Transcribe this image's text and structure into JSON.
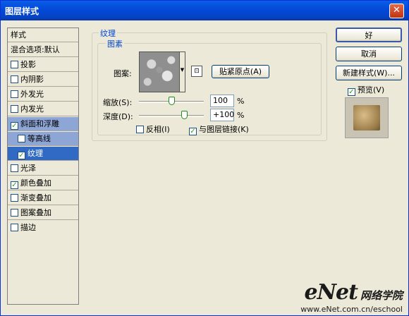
{
  "window": {
    "title": "图层样式",
    "close_glyph": "✕"
  },
  "sidebar": {
    "items": [
      {
        "label": "样式",
        "checkbox": false
      },
      {
        "label": "混合选项:默认",
        "checkbox": false
      },
      {
        "label": "投影",
        "checkbox": true,
        "checked": false
      },
      {
        "label": "内阴影",
        "checkbox": true,
        "checked": false
      },
      {
        "label": "外发光",
        "checkbox": true,
        "checked": false
      },
      {
        "label": "内发光",
        "checkbox": true,
        "checked": false
      },
      {
        "label": "斜面和浮雕",
        "checkbox": true,
        "checked": true
      },
      {
        "label": "等高线",
        "checkbox": true,
        "checked": false
      },
      {
        "label": "纹理",
        "checkbox": true,
        "checked": true
      },
      {
        "label": "光泽",
        "checkbox": true,
        "checked": false
      },
      {
        "label": "颜色叠加",
        "checkbox": true,
        "checked": true
      },
      {
        "label": "渐变叠加",
        "checkbox": true,
        "checked": false
      },
      {
        "label": "图案叠加",
        "checkbox": true,
        "checked": false
      },
      {
        "label": "描边",
        "checkbox": true,
        "checked": false
      }
    ]
  },
  "texture": {
    "group_title": "纹理",
    "sub_group_title": "图素",
    "pattern_label": "图案:",
    "snap_origin_button": "贴紧原点(A)",
    "scale_label": "缩放(S):",
    "scale_value": "100",
    "scale_level_percent": 100,
    "scale_unit": "%",
    "depth_label": "深度(D):",
    "depth_value": "+100",
    "depth_level_percent": 100,
    "depth_unit": "%",
    "invert_label": "反相(I)",
    "invert_checked": false,
    "link_label": "与图层链接(K)",
    "link_checked": true
  },
  "buttons": {
    "ok": "好",
    "cancel": "取消",
    "new_style": "新建样式(W)...",
    "preview_label": "预览(V)",
    "preview_checked": true
  },
  "watermark": {
    "brand": "eNet",
    "cn": "网络学院",
    "url": "www.eNet.com.cn/eschool"
  },
  "check_glyph": "✓"
}
